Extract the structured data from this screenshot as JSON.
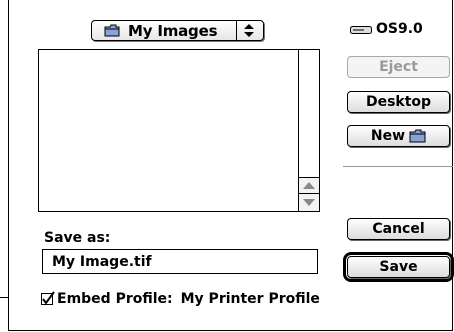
{
  "location_popup": {
    "label": "My Images",
    "icon": "folder-icon"
  },
  "volume": {
    "label": "OS9.0",
    "icon": "disk-icon"
  },
  "buttons": {
    "eject": "Eject",
    "desktop": "Desktop",
    "new": "New",
    "cancel": "Cancel",
    "save": "Save"
  },
  "save_as": {
    "label": "Save as:",
    "filename": "My Image.tif"
  },
  "embed_profile": {
    "label": "Embed Profile:",
    "profile_name": "My Printer Profile",
    "checked": true
  }
}
